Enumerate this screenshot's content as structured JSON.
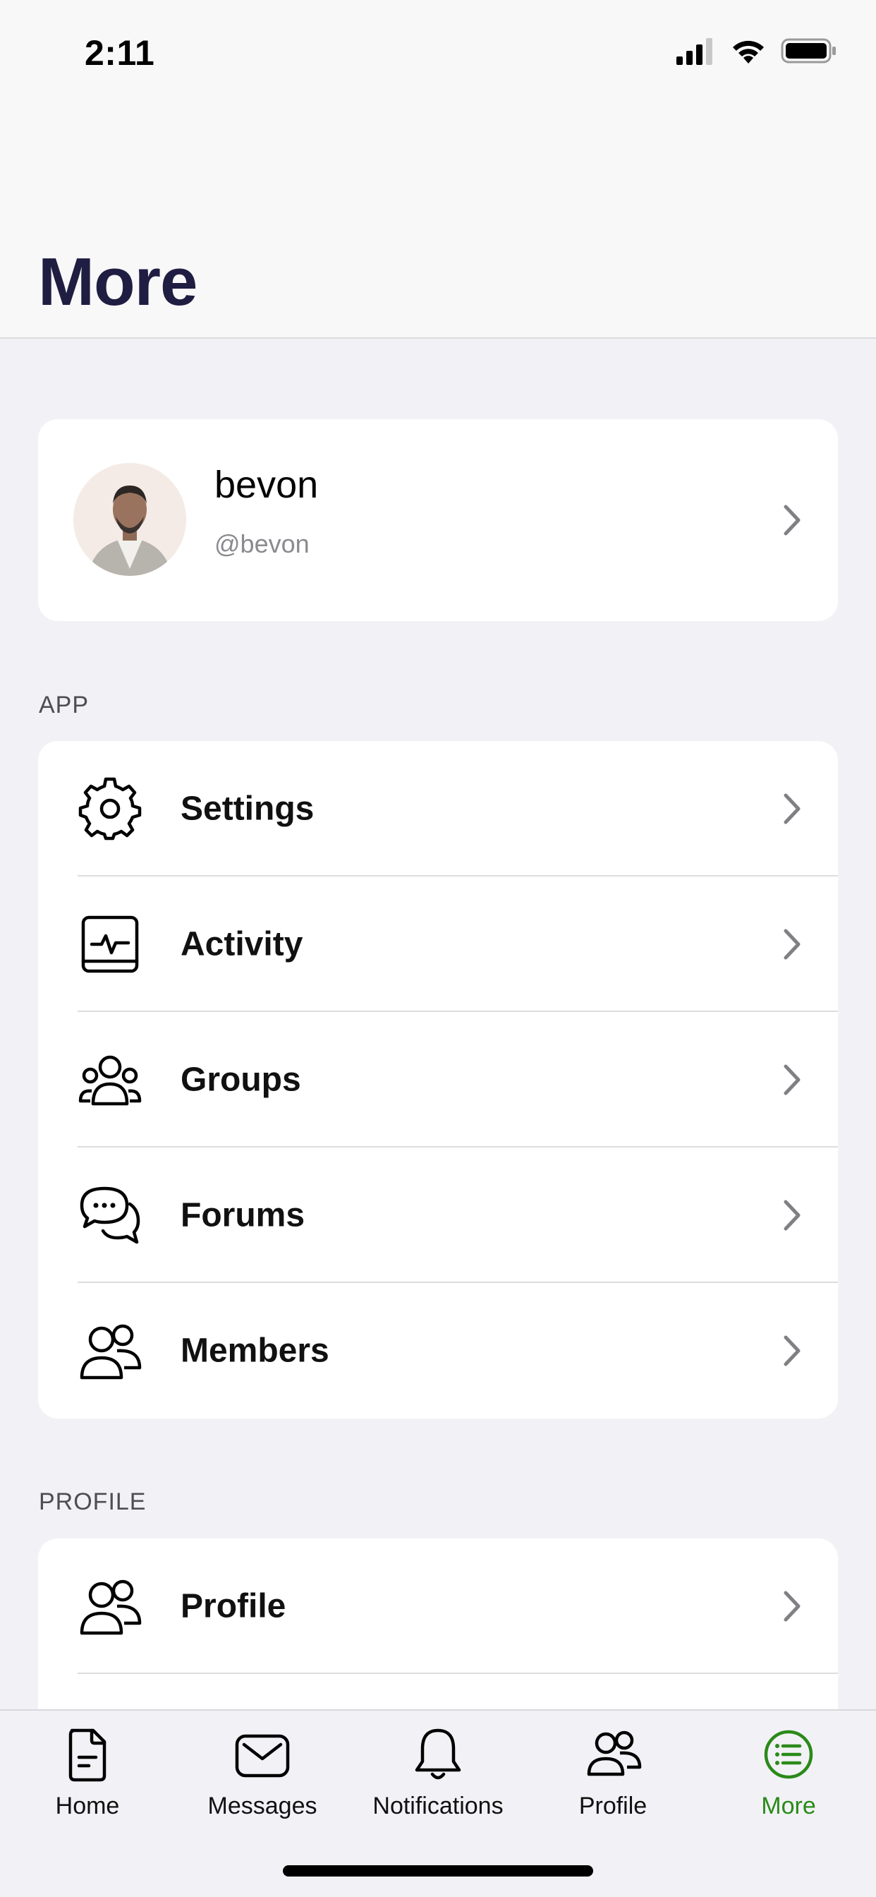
{
  "status_bar": {
    "time": "2:11"
  },
  "header": {
    "title": "More"
  },
  "profile_card": {
    "name": "bevon",
    "handle": "@bevon"
  },
  "sections": [
    {
      "label": "APP",
      "items": [
        {
          "label": "Settings",
          "icon": "gear-icon"
        },
        {
          "label": "Activity",
          "icon": "activity-icon"
        },
        {
          "label": "Groups",
          "icon": "groups-icon"
        },
        {
          "label": "Forums",
          "icon": "forums-icon"
        },
        {
          "label": "Members",
          "icon": "members-icon"
        }
      ]
    },
    {
      "label": "PROFILE",
      "items": [
        {
          "label": "Profile",
          "icon": "profile-icon"
        }
      ]
    }
  ],
  "tab_bar": {
    "tabs": [
      {
        "label": "Home",
        "icon": "document-icon",
        "active": false
      },
      {
        "label": "Messages",
        "icon": "envelope-icon",
        "active": false
      },
      {
        "label": "Notifications",
        "icon": "bell-icon",
        "active": false
      },
      {
        "label": "Profile",
        "icon": "people-icon",
        "active": false
      },
      {
        "label": "More",
        "icon": "list-icon",
        "active": true
      }
    ],
    "active_color": "#2a8a18"
  },
  "colors": {
    "title": "#1f1d42",
    "background": "#f2f2f6",
    "card": "#ffffff"
  }
}
